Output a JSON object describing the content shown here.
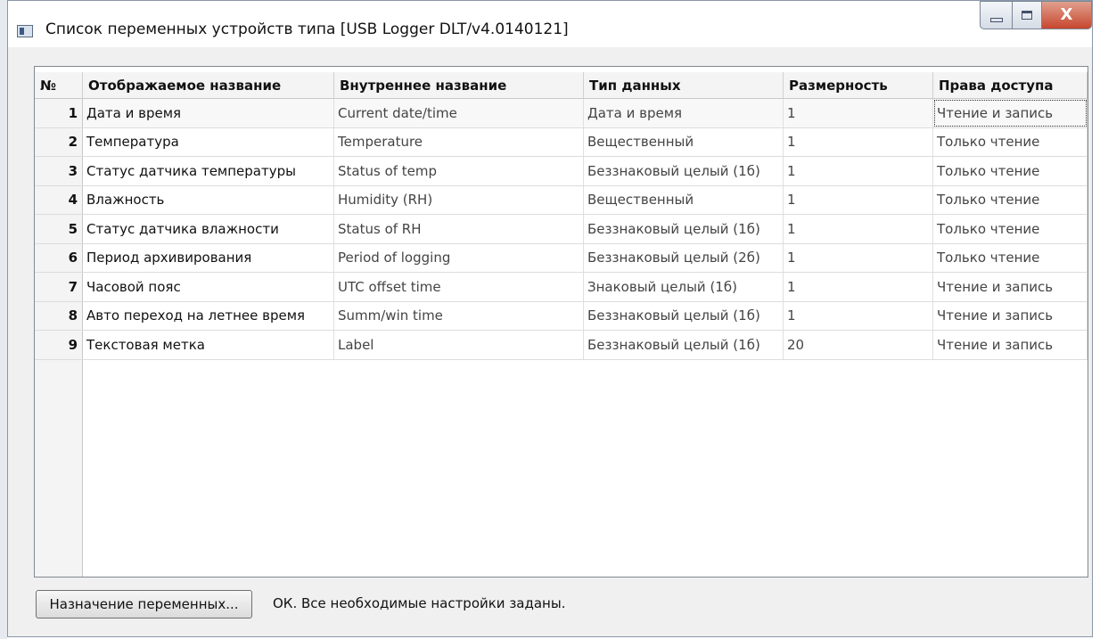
{
  "window": {
    "title": "Список переменных устройств типа [USB Logger DLT/v4.0140121]",
    "close_glyph": "X",
    "icons": [
      "app-icon",
      "minimize-icon",
      "maximize-icon",
      "close-icon"
    ]
  },
  "table": {
    "columns": [
      "№",
      "Отображаемое название",
      "Внутреннее название",
      "Тип данных",
      "Размерность",
      "Права доступа"
    ],
    "rows": [
      {
        "num": "1",
        "name": "Дата и время",
        "internal": "Current date/time",
        "type": "Дата и время",
        "dim": "1",
        "access": "Чтение и запись"
      },
      {
        "num": "2",
        "name": "Температура",
        "internal": "Temperature",
        "type": "Вещественный",
        "dim": "1",
        "access": "Только чтение"
      },
      {
        "num": "3",
        "name": "Статус датчика температуры",
        "internal": "Status of temp",
        "type": "Беззнаковый целый (1б)",
        "dim": "1",
        "access": "Только чтение"
      },
      {
        "num": "4",
        "name": "Влажность",
        "internal": "Humidity  (RH)",
        "type": "Вещественный",
        "dim": "1",
        "access": "Только чтение"
      },
      {
        "num": "5",
        "name": "Статус датчика влажности",
        "internal": "Status of  RH",
        "type": "Беззнаковый целый (1б)",
        "dim": "1",
        "access": "Только чтение"
      },
      {
        "num": "6",
        "name": "Период архивирования",
        "internal": "Period of logging",
        "type": "Беззнаковый целый (2б)",
        "dim": "1",
        "access": "Только чтение"
      },
      {
        "num": "7",
        "name": "Часовой пояс",
        "internal": "UTC offset time",
        "type": "Знаковый целый (1б)",
        "dim": "1",
        "access": "Чтение и запись"
      },
      {
        "num": "8",
        "name": "Авто переход на летнее время",
        "internal": "Summ/win time",
        "type": "Беззнаковый целый (1б)",
        "dim": "1",
        "access": "Чтение и запись"
      },
      {
        "num": "9",
        "name": "Текстовая метка",
        "internal": "Label",
        "type": "Беззнаковый целый (1б)",
        "dim": "20",
        "access": "Чтение и запись"
      }
    ]
  },
  "footer": {
    "assign_button": "Назначение переменных...",
    "status": "ОК. Все необходимые настройки заданы."
  }
}
